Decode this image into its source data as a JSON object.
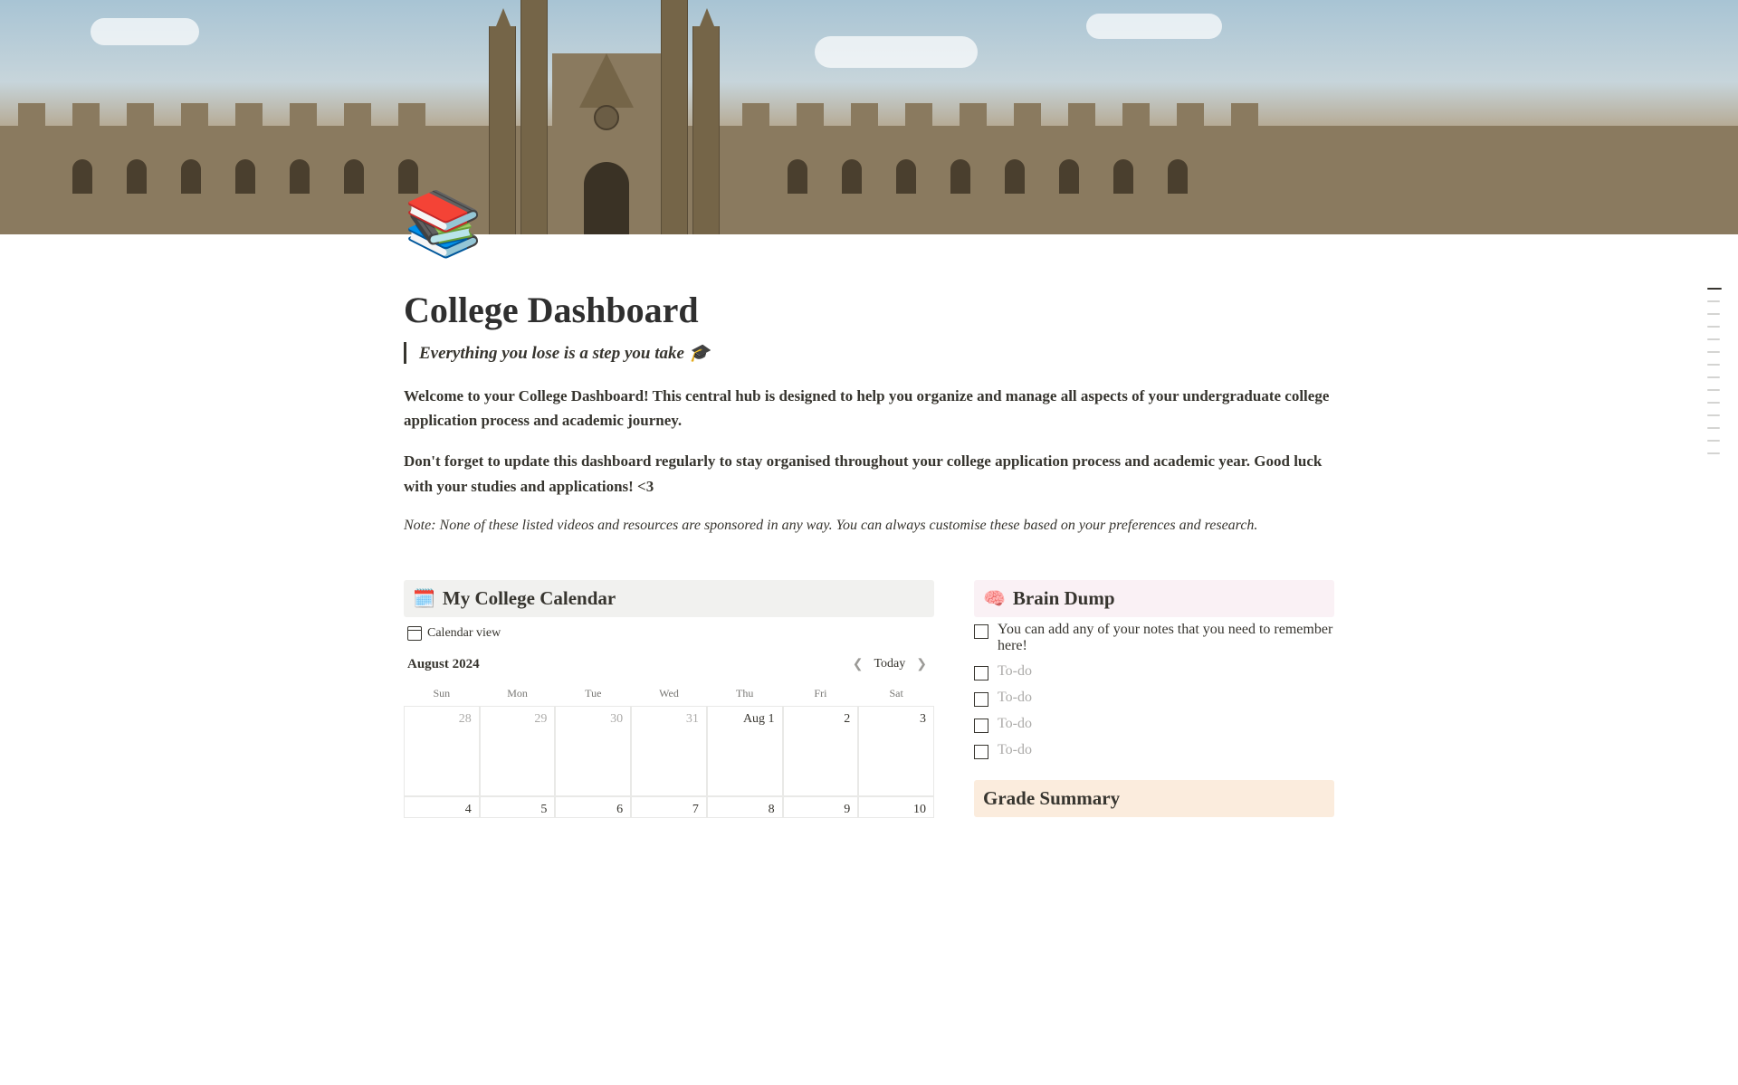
{
  "page": {
    "icon": "📚",
    "title": "College Dashboard",
    "quote": "Everything you lose is a step you take 🎓",
    "intro1": "Welcome to your College Dashboard! This central hub is designed to help you organize and manage all aspects of your undergraduate college application process and academic journey.",
    "intro2": "Don't forget to update this dashboard regularly to stay organised throughout your college application process and academic year. Good luck with your studies and applications! <3",
    "note": "Note: None of these listed videos and resources are sponsored in any way. You can always customise these based on your preferences and research."
  },
  "calendar": {
    "icon": "🗓️",
    "title": "My College Calendar",
    "view_label": "Calendar view",
    "month_label": "August 2024",
    "today_label": "Today",
    "day_headers": [
      "Sun",
      "Mon",
      "Tue",
      "Wed",
      "Thu",
      "Fri",
      "Sat"
    ],
    "cells": [
      {
        "label": "28",
        "other": true
      },
      {
        "label": "29",
        "other": true
      },
      {
        "label": "30",
        "other": true
      },
      {
        "label": "31",
        "other": true
      },
      {
        "label": "Aug 1",
        "other": false
      },
      {
        "label": "2",
        "other": false
      },
      {
        "label": "3",
        "other": false
      },
      {
        "label": "4",
        "other": false
      },
      {
        "label": "5",
        "other": false
      },
      {
        "label": "6",
        "other": false
      },
      {
        "label": "7",
        "other": false
      },
      {
        "label": "8",
        "other": false
      },
      {
        "label": "9",
        "other": false
      },
      {
        "label": "10",
        "other": false
      }
    ]
  },
  "brain_dump": {
    "icon": "🧠",
    "title": "Brain Dump",
    "items": [
      {
        "text": "You can add any of your notes that you need to remember here!",
        "placeholder": false
      },
      {
        "text": "To-do",
        "placeholder": true
      },
      {
        "text": "To-do",
        "placeholder": true
      },
      {
        "text": "To-do",
        "placeholder": true
      },
      {
        "text": "To-do",
        "placeholder": true
      }
    ]
  },
  "grade_summary": {
    "title": "Grade Summary"
  }
}
